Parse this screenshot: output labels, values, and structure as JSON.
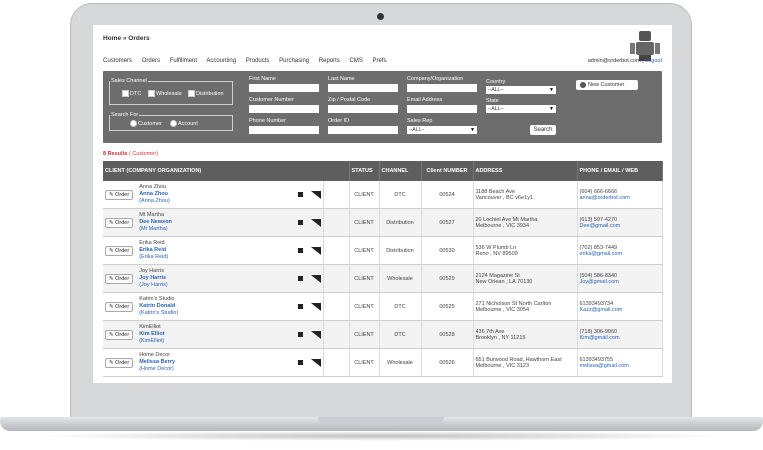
{
  "breadcrumb": "Home » Orders",
  "menu": [
    "Customers",
    "Orders",
    "Fulfillment",
    "Accounting",
    "Products",
    "Purchasing",
    "Reports",
    "CMS",
    "Prefs"
  ],
  "account": {
    "email": "admin@orderbot.com",
    "sep": " | ",
    "logout": "Logout"
  },
  "search": {
    "sales_channel_label": "Sales Channel",
    "channels": [
      "DTC",
      "Wholesale",
      "Distribution"
    ],
    "search_for_label": "Search For",
    "search_for_options": [
      "Customer",
      "Account"
    ],
    "fields": {
      "first_name": "First Name",
      "last_name": "Last Name",
      "company": "Company/Organization",
      "customer_number": "Customer Number",
      "zip": "Zip / Postal Code",
      "email": "Email Address",
      "phone": "Phone Number",
      "order_id": "Order ID",
      "sales_rep": "Sales Rep"
    },
    "country_label": "Country",
    "country_value": "--ALL--",
    "state_label": "State",
    "state_value": "--ALL--",
    "sales_rep_value": "--ALL--",
    "new_customer": "New Customer",
    "search_button": "Search"
  },
  "results_count": "8 Results",
  "results_suffix": " ( Customer)",
  "columns": [
    "CLIENT (COMPANY ORGANIZATION)",
    "STATUS",
    "CHANNEL",
    "Client NUMBER",
    "ADDRESS",
    "PHONE / EMAIL / WEB"
  ],
  "order_label": "Order",
  "rows": [
    {
      "line1": "Anna Zhou",
      "line2": "Anna Zhou",
      "line3": "(Anna Zhou)",
      "status": "CLIENT",
      "channel": "DTC",
      "number": "00524",
      "addr1": "1188 Beach Ave",
      "addr2": "Vancouver , BC v6e1y1",
      "phone": "(604) 666-6666",
      "email": "anna@orderbot.com"
    },
    {
      "line1": "Mt Martha",
      "line2": "Dee Newson",
      "line3": "(Mt Martha)",
      "status": "CLIENT",
      "channel": "Distribution",
      "number": "00527",
      "addr1": "20 Lochiel Ave Mt Martha",
      "addr2": "Melbourne , VIC 3934",
      "phone": "(613) 597-4270",
      "email": "Dee@gmail.com"
    },
    {
      "line1": "Erika Reid",
      "line2": "Erika Reid",
      "line3": "(Erika Reid)",
      "status": "CLIENT",
      "channel": "Distribution",
      "number": "00530",
      "addr1": "536 W Plumb Ln",
      "addr2": "Reno , NV 89509",
      "phone": "(702) 853-7449",
      "email": "erika@gmail.com"
    },
    {
      "line1": "Joy Harris",
      "line2": "Joy Harris",
      "line3": "(Joy Harris)",
      "status": "CLIENT",
      "channel": "Wholesale",
      "number": "00529",
      "addr1": "2124 Magazine St",
      "addr2": "New Orlean , LA 70130",
      "phone": "(504) 586-8340",
      "email": "Joy@gmail.com"
    },
    {
      "line1": "Katrin's Studio",
      "line2": "Katrin Donald",
      "line3": "(Katrin's Studio)",
      "status": "CLIENT",
      "channel": "DTC",
      "number": "00525",
      "addr1": "271 Nicholson St North Carlton",
      "addr2": "Melbourne , VIC 3054",
      "phone": "61393493734",
      "email": "Kazz@gmail.com"
    },
    {
      "line1": "KimElliot",
      "line2": "Kim Elliot",
      "line3": "(KimElliot)",
      "status": "CLIENT",
      "channel": "DTC",
      "number": "00528",
      "addr1": "436 7th Ave",
      "addr2": "Brooklyn , NY 11215",
      "phone": "(718) 306-9060",
      "email": "Kim@gmail.com"
    },
    {
      "line1": "Home Decor",
      "line2": "Melissa Berry",
      "line3": "(Home Decor)",
      "status": "CLIENT",
      "channel": "Wholesale",
      "number": "00526",
      "addr1": "651 Burwood Road, Hawthorn East",
      "addr2": "Melbourne , VIC 3123",
      "phone": "61393493755",
      "email": "melissa@gmail.com"
    }
  ]
}
